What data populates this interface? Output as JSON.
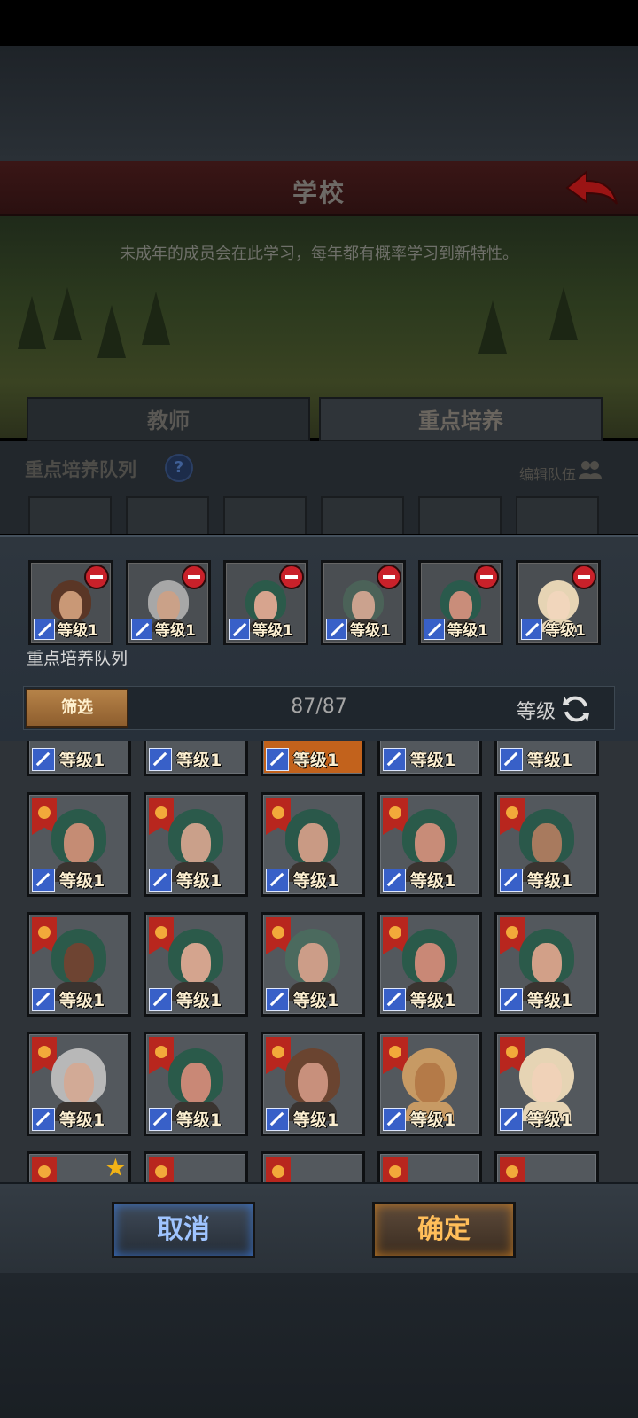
{
  "header": {
    "title": "学校",
    "description": "未成年的成员会在此学习，每年都有概率学习到新特性。"
  },
  "tabs": [
    {
      "label": "教师"
    },
    {
      "label": "重点培养"
    }
  ],
  "background_section": {
    "queue_label": "重点培养队列",
    "help_symbol": "?",
    "edit_team_label": "编辑队伍"
  },
  "selected": {
    "slots": [
      {
        "level_text": "等级1",
        "hair": "#5a3626",
        "skin": "#c99876",
        "kind": "person"
      },
      {
        "level_text": "等级1",
        "hair": "#a7a7a7",
        "skin": "#caa188",
        "kind": "person"
      },
      {
        "level_text": "等级1",
        "hair": "#2b5a4a",
        "skin": "#d7a48e",
        "kind": "person"
      },
      {
        "level_text": "等级1",
        "hair": "#4b6258",
        "skin": "#cba28e",
        "kind": "person"
      },
      {
        "level_text": "等级1",
        "hair": "#2a5a4c",
        "skin": "#c98d7a",
        "kind": "person"
      },
      {
        "level_text": "等级1",
        "hair": "#e6d4b4",
        "skin": "#f1d6bc",
        "kind": "baby"
      }
    ],
    "queue_label": "重点培养队列"
  },
  "filter": {
    "button_label": "筛选",
    "count": "87/87",
    "sort_label": "等级"
  },
  "roster": {
    "partial_row": [
      {
        "level_text": "等级1"
      },
      {
        "level_text": "等级1"
      },
      {
        "level_text": "等级1"
      },
      {
        "level_text": "等级1"
      },
      {
        "level_text": "等级1"
      }
    ],
    "rows": [
      [
        {
          "level_text": "等级1",
          "hair": "#2a5a4a",
          "skin": "#c58c74",
          "kind": "person"
        },
        {
          "level_text": "等级1",
          "hair": "#2b5a4b",
          "skin": "#caa08a",
          "kind": "person"
        },
        {
          "level_text": "等级1",
          "hair": "#2a584a",
          "skin": "#c99a84",
          "kind": "person"
        },
        {
          "level_text": "等级1",
          "hair": "#2a5a4a",
          "skin": "#c88c78",
          "kind": "person"
        },
        {
          "level_text": "等级1",
          "hair": "#2a584a",
          "skin": "#a87a5e",
          "kind": "person"
        }
      ],
      [
        {
          "level_text": "等级1",
          "hair": "#2b5a4a",
          "skin": "#6e4432",
          "kind": "person"
        },
        {
          "level_text": "等级1",
          "hair": "#2b5a4a",
          "skin": "#d4a48e",
          "kind": "person"
        },
        {
          "level_text": "等级1",
          "hair": "#4b6a5e",
          "skin": "#cc9d88",
          "kind": "person"
        },
        {
          "level_text": "等级1",
          "hair": "#2a5a4a",
          "skin": "#c98876",
          "kind": "person"
        },
        {
          "level_text": "等级1",
          "hair": "#2b5a4a",
          "skin": "#d2a088",
          "kind": "person"
        }
      ],
      [
        {
          "level_text": "等级1",
          "hair": "#b8b8b8",
          "skin": "#d2aa96",
          "kind": "person"
        },
        {
          "level_text": "等级1",
          "hair": "#2a5a4a",
          "skin": "#c98876",
          "kind": "person"
        },
        {
          "level_text": "等级1",
          "hair": "#6a4430",
          "skin": "#c8907c",
          "kind": "person"
        },
        {
          "level_text": "等级1",
          "hair": "#c79a64",
          "skin": "#b47a48",
          "kind": "baby"
        },
        {
          "level_text": "等级1",
          "hair": "#e6d4b4",
          "skin": "#f0d2b8",
          "kind": "baby"
        }
      ]
    ]
  },
  "buttons": {
    "cancel": "取消",
    "confirm": "确定"
  }
}
